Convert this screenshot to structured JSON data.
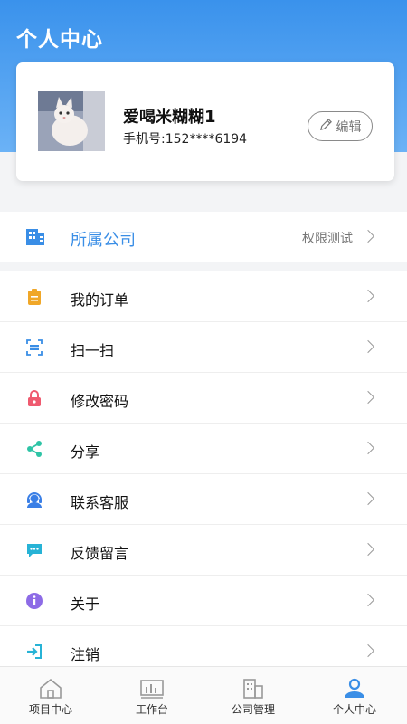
{
  "header": {
    "title": "个人中心"
  },
  "profile": {
    "name": "爱喝米糊糊1",
    "phone": "手机号:152****6194",
    "edit_label": "编辑"
  },
  "company": {
    "label": "所属公司",
    "value": "权限测试"
  },
  "menu": [
    {
      "label": "我的订单",
      "icon": "order-icon"
    },
    {
      "label": "扫一扫",
      "icon": "scan-icon"
    },
    {
      "label": "修改密码",
      "icon": "lock-icon"
    },
    {
      "label": "分享",
      "icon": "share-icon"
    },
    {
      "label": "联系客服",
      "icon": "customer-service-icon"
    },
    {
      "label": "反馈留言",
      "icon": "feedback-icon"
    },
    {
      "label": "关于",
      "icon": "info-icon"
    },
    {
      "label": "注销",
      "icon": "logout-icon"
    }
  ],
  "tabs": [
    {
      "label": "项目中心",
      "icon": "home-icon",
      "active": false
    },
    {
      "label": "工作台",
      "icon": "workbench-icon",
      "active": false
    },
    {
      "label": "公司管理",
      "icon": "building-icon",
      "active": false
    },
    {
      "label": "个人中心",
      "icon": "profile-icon",
      "active": true
    }
  ],
  "colors": {
    "header": "#3a92ec",
    "accent": "#3a8ee6"
  }
}
